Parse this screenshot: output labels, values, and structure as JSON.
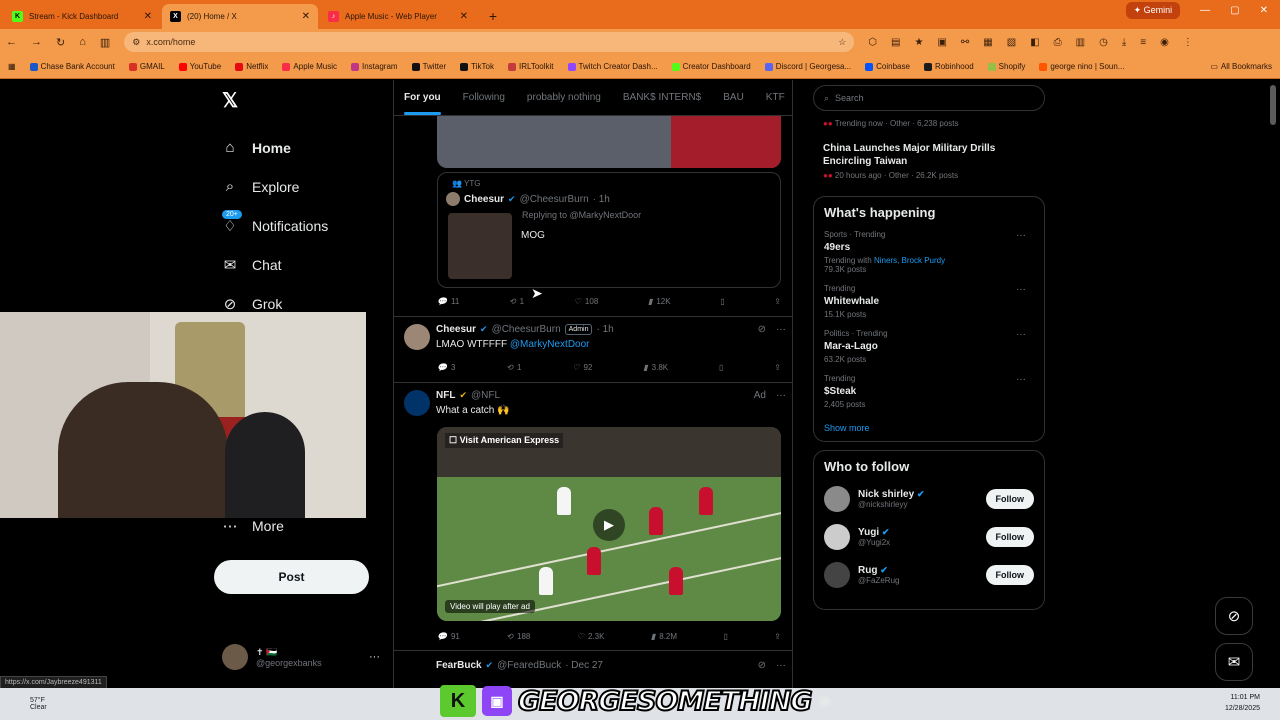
{
  "browser": {
    "tabs": [
      {
        "title": "Stream - Kick Dashboard",
        "color": "#53fc18"
      },
      {
        "title": "(20) Home / X",
        "color": "#000000"
      },
      {
        "title": "Apple Music - Web Player",
        "color": "#fa2d48"
      }
    ],
    "gemini_label": "Gemini",
    "url": "x.com/home",
    "bookmarks": [
      {
        "label": "Chase Bank Account",
        "color": "#1a57c8"
      },
      {
        "label": "GMAIL",
        "color": "#d93025"
      },
      {
        "label": "YouTube",
        "color": "#ff0000"
      },
      {
        "label": "Netflix",
        "color": "#e50914"
      },
      {
        "label": "Apple Music",
        "color": "#fa2d48"
      },
      {
        "label": "Instagram",
        "color": "#c13584"
      },
      {
        "label": "Twitter",
        "color": "#111111"
      },
      {
        "label": "TikTok",
        "color": "#111111"
      },
      {
        "label": "IRLToolkit",
        "color": "#c43b3b"
      },
      {
        "label": "Twitch Creator Dash...",
        "color": "#9146ff"
      },
      {
        "label": "Creator Dashboard",
        "color": "#53fc18"
      },
      {
        "label": "Discord | Georgesa...",
        "color": "#5865f2"
      },
      {
        "label": "Coinbase",
        "color": "#0052ff"
      },
      {
        "label": "Robinhood",
        "color": "#1b1b1b"
      },
      {
        "label": "Shopify",
        "color": "#95bf47"
      },
      {
        "label": "george nino | Soun...",
        "color": "#ff5500"
      }
    ],
    "all_bookmarks": "All Bookmarks"
  },
  "nav": {
    "items": [
      {
        "label": "Home",
        "icon": "home-icon"
      },
      {
        "label": "Explore",
        "icon": "search-icon"
      },
      {
        "label": "Notifications",
        "icon": "bell-icon",
        "badge": "20+"
      },
      {
        "label": "Chat",
        "icon": "mail-icon"
      },
      {
        "label": "Grok",
        "icon": "grok-icon"
      }
    ],
    "more": "More",
    "post": "Post",
    "account_handle": "@georgexbanks",
    "account_name": "✝ 🇵🇸"
  },
  "feed": {
    "tabs": [
      "For you",
      "Following",
      "probably nothing",
      "BANK$ INTERN$",
      "BAU",
      "KTF"
    ],
    "quote": {
      "label": "YTG",
      "name": "Cheesur",
      "handle": "@CheesurBurn",
      "time": "· 1h",
      "replying": "Replying to @MarkyNextDoor",
      "text": "MOG"
    },
    "quote_actions": {
      "replies": "11",
      "reposts": "1",
      "likes": "108",
      "views": "12K"
    },
    "tweet1": {
      "name": "Cheesur",
      "handle": "@CheesurBurn",
      "badge": "Admin",
      "time": "· 1h",
      "text": "LMAO WTFFFF",
      "mention": "@MarkyNextDoor",
      "replies": "3",
      "reposts": "1",
      "likes": "92",
      "views": "3.8K"
    },
    "tweet2": {
      "name": "NFL",
      "handle": "@NFL",
      "ad": "Ad",
      "text": "What a catch 🙌",
      "video_label": "Visit American Express",
      "video_note": "Video will play after ad",
      "replies": "91",
      "reposts": "188",
      "likes": "2.3K",
      "views": "8.2M"
    },
    "tweet3": {
      "name": "FearBuck",
      "handle": "@FearedBuck",
      "time": "· Dec 27"
    }
  },
  "sidebar_right": {
    "search_placeholder": "Search",
    "trending_top": {
      "meta": "Trending now · Other · 6,238 posts"
    },
    "news": {
      "title": "China Launches Major Military Drills Encircling Taiwan",
      "meta": "20 hours ago · Other · 26.2K posts"
    },
    "happening_title": "What's happening",
    "trends": [
      {
        "category": "Sports · Trending",
        "name": "49ers",
        "extra": "Trending with",
        "links": "Niners, Brock Purdy",
        "posts": "79.3K posts"
      },
      {
        "category": "Trending",
        "name": "Whitewhale",
        "posts": "15.1K posts"
      },
      {
        "category": "Politics · Trending",
        "name": "Mar-a-Lago",
        "posts": "63.2K posts"
      },
      {
        "category": "Trending",
        "name": "$Steak",
        "posts": "2,405 posts"
      }
    ],
    "show_more": "Show more",
    "who_to_follow_title": "Who to follow",
    "follow_suggestions": [
      {
        "name": "Nick shirley",
        "handle": "@nickshirleyy"
      },
      {
        "name": "Yugi",
        "handle": "@Yugi2x"
      },
      {
        "name": "Rug",
        "handle": "@FaZeRug"
      }
    ],
    "follow_label": "Follow"
  },
  "status_url": "https://x.com/Jaybreeze491311",
  "taskbar": {
    "temperature": "57°F",
    "condition": "Clear",
    "time": "11:01 PM",
    "date": "12/28/2025",
    "stream_banner": "GEORGESOMETHING"
  }
}
